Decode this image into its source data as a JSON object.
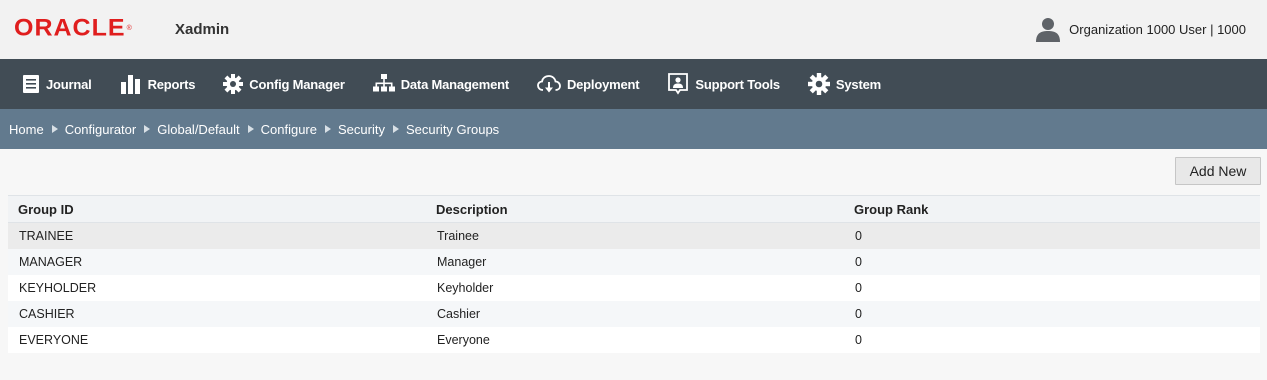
{
  "header": {
    "logo": "ORACLE",
    "app_name": "Xadmin",
    "user_label": "Organization 1000 User | 1000"
  },
  "nav": {
    "items": [
      {
        "label": "Journal",
        "icon": "journal-icon"
      },
      {
        "label": "Reports",
        "icon": "reports-icon"
      },
      {
        "label": "Config Manager",
        "icon": "gear-icon"
      },
      {
        "label": "Data Management",
        "icon": "hierarchy-icon"
      },
      {
        "label": "Deployment",
        "icon": "cloud-download-icon"
      },
      {
        "label": "Support Tools",
        "icon": "support-user-icon"
      },
      {
        "label": "System",
        "icon": "gear-icon"
      }
    ]
  },
  "breadcrumb": [
    "Home",
    "Configurator",
    "Global/Default",
    "Configure",
    "Security",
    "Security Groups"
  ],
  "toolbar": {
    "add_label": "Add New"
  },
  "table": {
    "columns": [
      "Group ID",
      "Description",
      "Group Rank"
    ],
    "rows": [
      [
        "TRAINEE",
        "Trainee",
        "0"
      ],
      [
        "MANAGER",
        "Manager",
        "0"
      ],
      [
        "KEYHOLDER",
        "Keyholder",
        "0"
      ],
      [
        "CASHIER",
        "Cashier",
        "0"
      ],
      [
        "EVERYONE",
        "Everyone",
        "0"
      ]
    ]
  },
  "colors": {
    "brand_red": "#e01e1e",
    "nav_bg": "#414c55",
    "breadcrumb_bg": "#627a8e"
  }
}
